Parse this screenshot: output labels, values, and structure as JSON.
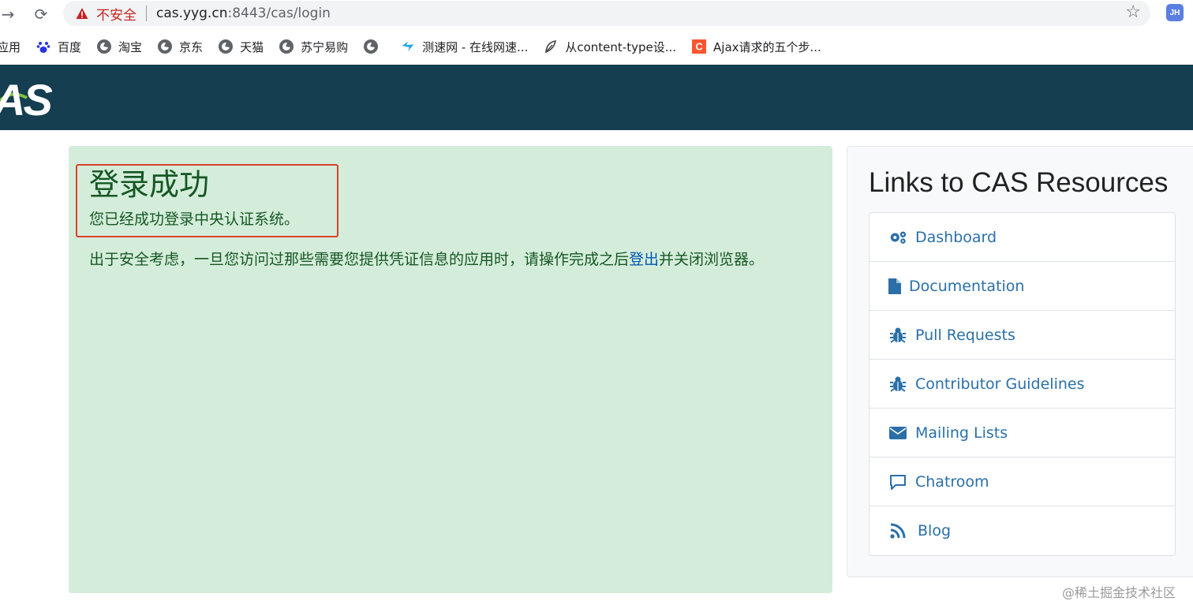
{
  "browser": {
    "insecure_label": "不安全",
    "url_host": "cas.yyg.cn",
    "url_rest": ":8443/cas/login",
    "profile_initials": "JH",
    "bookmarks": [
      {
        "label": "应用",
        "icon": "apps-icon"
      },
      {
        "label": "百度",
        "icon": "baidu-paw-icon"
      },
      {
        "label": "淘宝",
        "icon": "globe-icon"
      },
      {
        "label": "京东",
        "icon": "globe-icon"
      },
      {
        "label": "天猫",
        "icon": "globe-icon"
      },
      {
        "label": "苏宁易购",
        "icon": "globe-icon"
      },
      {
        "label": "",
        "icon": "globe-icon"
      },
      {
        "label": "测速网 - 在线网速...",
        "icon": "speedtest-icon"
      },
      {
        "label": "从content-type设...",
        "icon": "leaf-icon"
      },
      {
        "label": "Ajax请求的五个步...",
        "icon": "csdn-icon"
      }
    ]
  },
  "header": {
    "logo_text": "AS"
  },
  "success": {
    "title": "登录成功",
    "subtitle": "您已经成功登录中央认证系统。",
    "note_before": "出于安全考虑，一旦您访问过那些需要您提供凭证信息的应用时，请操作完成之后",
    "note_link": "登出",
    "note_after": "并关闭浏览器。"
  },
  "resources": {
    "title": "Links to CAS Resources",
    "items": [
      {
        "label": "Dashboard",
        "icon": "gears-icon"
      },
      {
        "label": "Documentation",
        "icon": "file-icon"
      },
      {
        "label": "Pull Requests",
        "icon": "bug-icon"
      },
      {
        "label": "Contributor Guidelines",
        "icon": "bug-icon"
      },
      {
        "label": "Mailing Lists",
        "icon": "envelope-icon"
      },
      {
        "label": "Chatroom",
        "icon": "chat-icon"
      },
      {
        "label": "Blog",
        "icon": "rss-icon"
      }
    ]
  },
  "watermark": "@稀土掘金技术社区",
  "colors": {
    "header_bg": "#153e50",
    "success_bg": "#d4edda",
    "success_text": "#155724",
    "link": "#2a6fa8",
    "highlight": "#d9412b"
  }
}
